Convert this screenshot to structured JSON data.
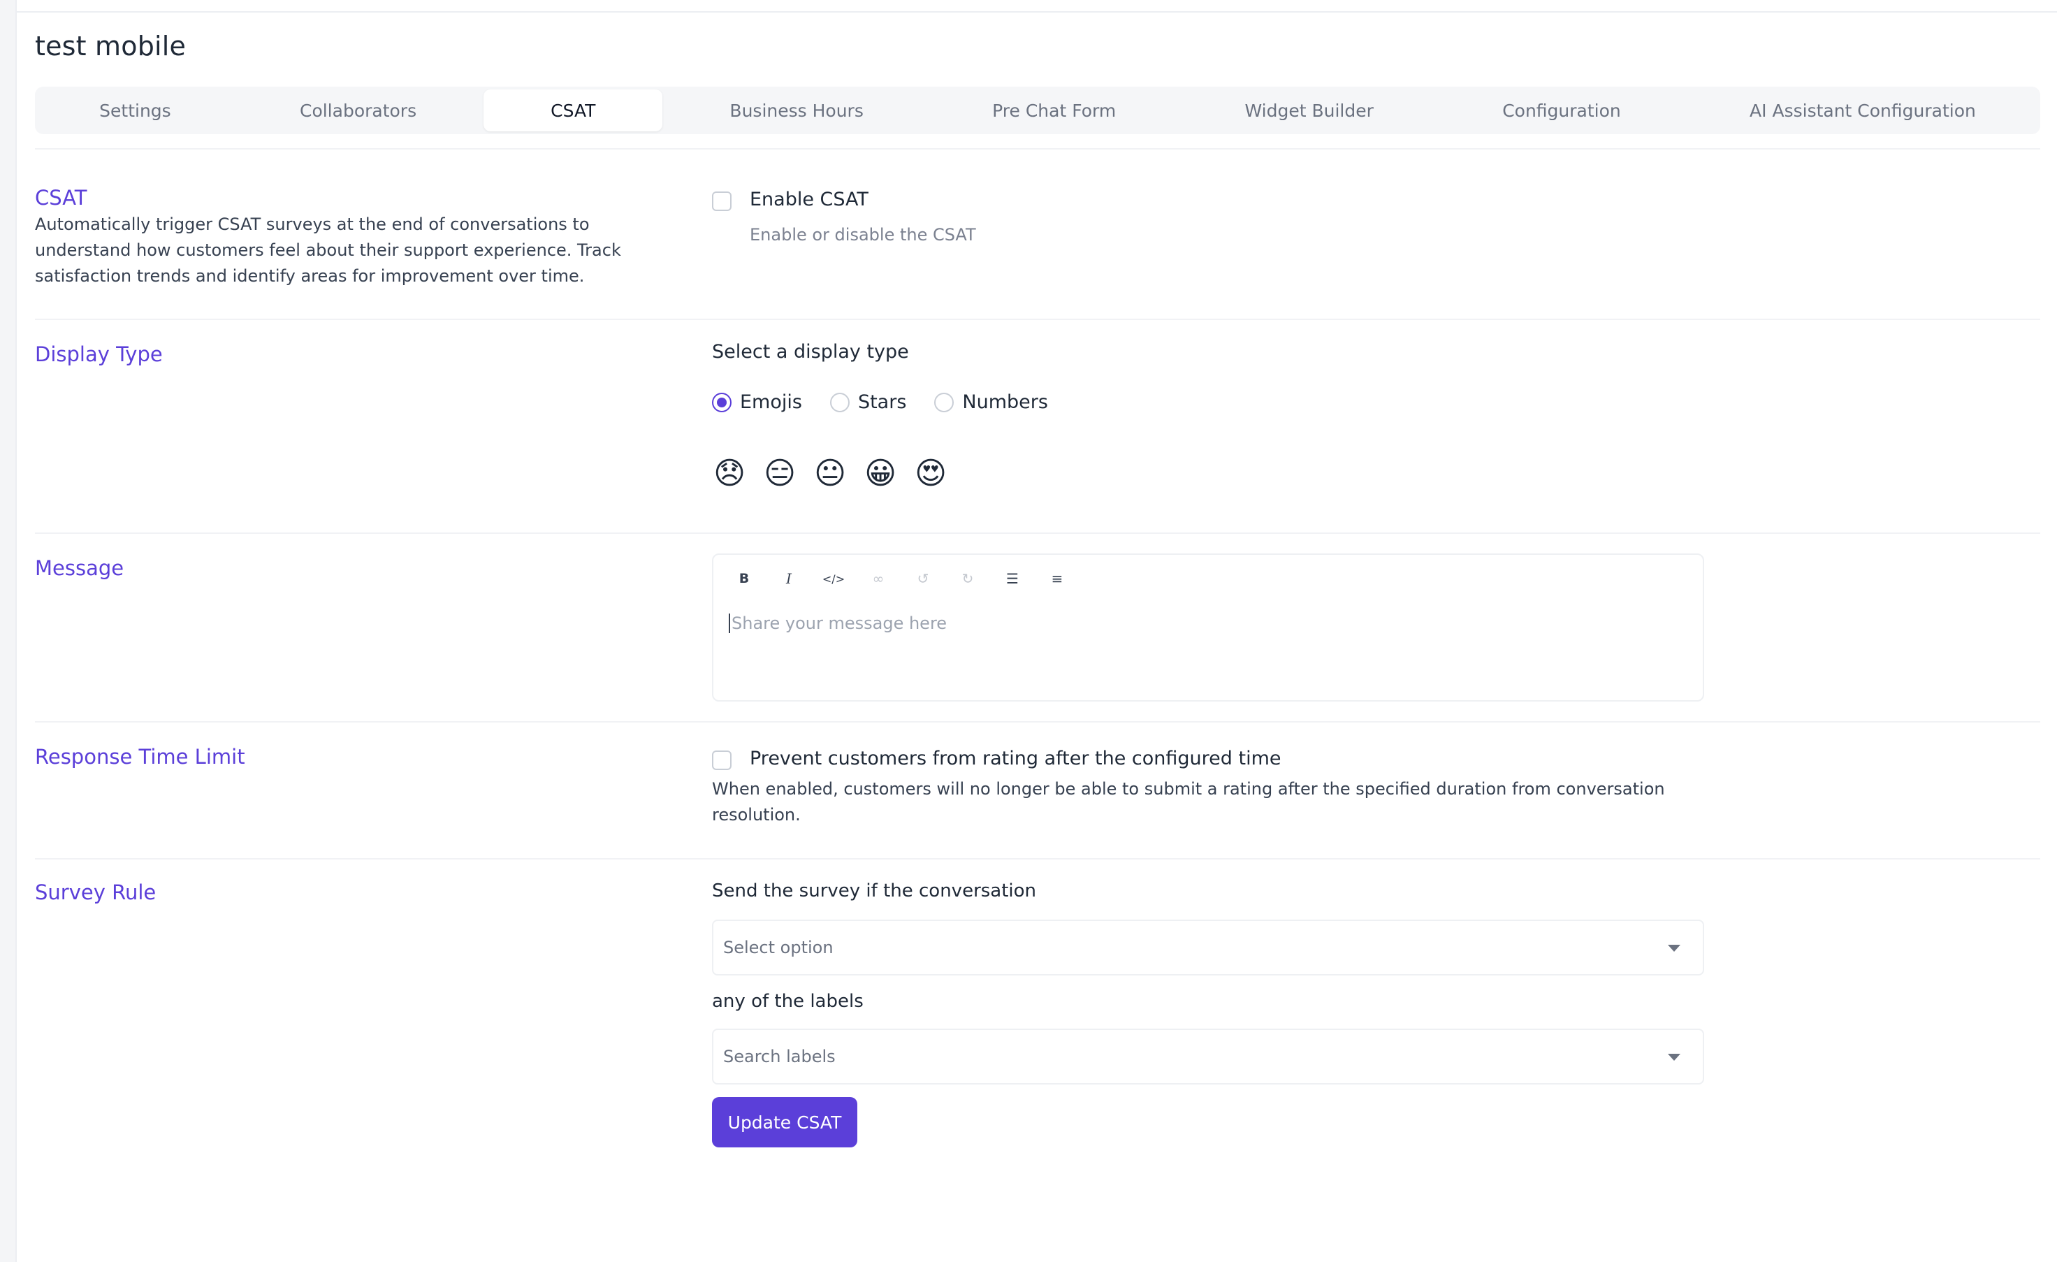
{
  "page": {
    "title": "test mobile"
  },
  "tabs": [
    {
      "label": "Settings"
    },
    {
      "label": "Collaborators"
    },
    {
      "label": "CSAT"
    },
    {
      "label": "Business Hours"
    },
    {
      "label": "Pre Chat Form"
    },
    {
      "label": "Widget Builder"
    },
    {
      "label": "Configuration"
    },
    {
      "label": "AI Assistant Configuration"
    }
  ],
  "csat": {
    "title": "CSAT",
    "description": "Automatically trigger CSAT surveys at the end of conversations to understand how customers feel about their support experience. Track satisfaction trends and identify areas for improvement over time.",
    "enable_label": "Enable CSAT",
    "enable_help": "Enable or disable the CSAT",
    "enabled": false
  },
  "display_type": {
    "title": "Display Type",
    "prompt": "Select a display type",
    "options": [
      {
        "label": "Emojis",
        "selected": true
      },
      {
        "label": "Stars",
        "selected": false
      },
      {
        "label": "Numbers",
        "selected": false
      }
    ],
    "emojis": [
      "😞",
      "😑",
      "😐",
      "😀",
      "😍"
    ]
  },
  "message": {
    "title": "Message",
    "placeholder": "Share your message here",
    "toolbar": [
      {
        "icon": "bold-icon",
        "glyph": "B",
        "enabled": true
      },
      {
        "icon": "italic-icon",
        "glyph": "I",
        "enabled": true
      },
      {
        "icon": "code-icon",
        "glyph": "</>",
        "enabled": true
      },
      {
        "icon": "link-icon",
        "glyph": "∞",
        "enabled": false
      },
      {
        "icon": "undo-icon",
        "glyph": "↺",
        "enabled": false
      },
      {
        "icon": "redo-icon",
        "glyph": "↻",
        "enabled": false
      },
      {
        "icon": "bullet-list-icon",
        "glyph": "☰",
        "enabled": true
      },
      {
        "icon": "numbered-list-icon",
        "glyph": "≡",
        "enabled": true
      }
    ]
  },
  "response_time": {
    "title": "Response Time Limit",
    "checkbox_label": "Prevent customers from rating after the configured time",
    "help": "When enabled, customers will no longer be able to submit a rating after the specified duration from conversation resolution.",
    "enabled": false
  },
  "survey_rule": {
    "title": "Survey Rule",
    "prompt": "Send the survey if the conversation",
    "select_placeholder": "Select option",
    "labels_prompt": "any of the labels",
    "labels_placeholder": "Search labels",
    "submit_label": "Update CSAT"
  },
  "colors": {
    "accent": "#5b3fd9"
  }
}
